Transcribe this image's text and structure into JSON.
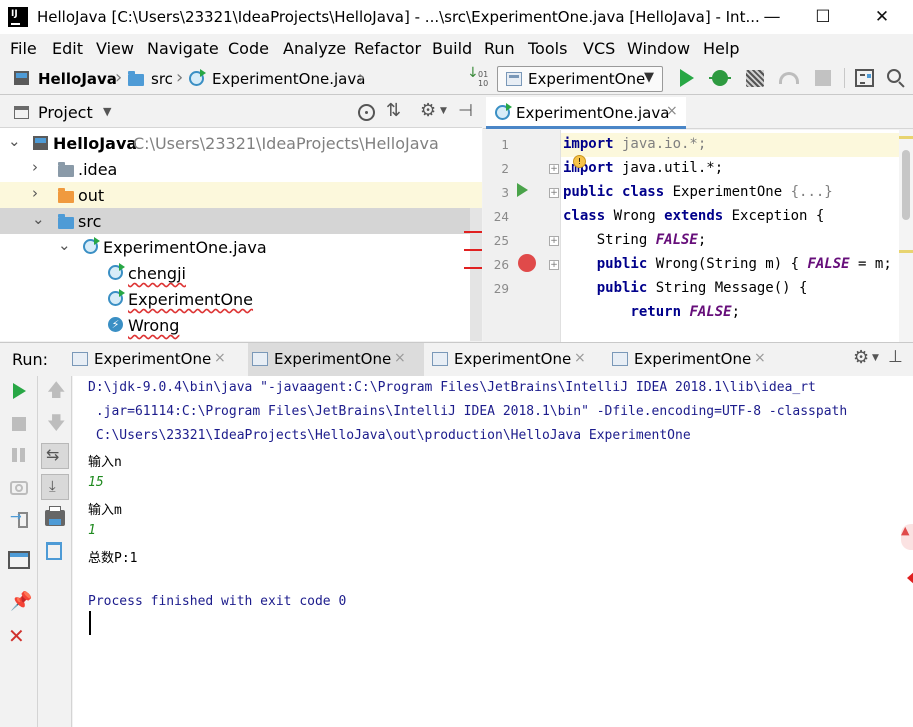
{
  "window": {
    "title": "HelloJava [C:\\Users\\23321\\IdeaProjects\\HelloJava] - ...\\src\\ExperimentOne.java [HelloJava] - Int...",
    "minimize": "—",
    "maximize": "☐",
    "close": "✕"
  },
  "menu": [
    "File",
    "Edit",
    "View",
    "Navigate",
    "Code",
    "Analyze",
    "Refactor",
    "Build",
    "Run",
    "Tools",
    "VCS",
    "Window",
    "Help"
  ],
  "breadcrumbs": {
    "project": "HelloJava",
    "folder": "src",
    "file": "ExperimentOne.java"
  },
  "run_config": "ExperimentOne",
  "project_panel": {
    "title": "Project",
    "root": "HelloJava",
    "root_path": "C:\\Users\\23321\\IdeaProjects\\HelloJava",
    "items": [
      ".idea",
      "out",
      "src",
      "ExperimentOne.java",
      "chengji",
      "ExperimentOne",
      "Wrong"
    ]
  },
  "editor": {
    "tab": "ExperimentOne.java",
    "lines": [
      {
        "num": "1",
        "parts": [
          [
            "kw",
            "import"
          ],
          [
            "cm",
            " java.io.*;"
          ]
        ]
      },
      {
        "num": "2",
        "parts": [
          [
            "kw",
            "import"
          ],
          [
            "t",
            " java.util.*;"
          ]
        ]
      },
      {
        "num": "3",
        "parts": [
          [
            "kw",
            "public class"
          ],
          [
            "t",
            " ExperimentOne "
          ],
          [
            "cm",
            "{...}"
          ]
        ]
      },
      {
        "num": "24",
        "parts": [
          [
            "kw",
            "class"
          ],
          [
            "t",
            " Wrong "
          ],
          [
            "kw",
            "extends"
          ],
          [
            "t",
            " Exception {"
          ]
        ]
      },
      {
        "num": "25",
        "parts": [
          [
            "t",
            "    String "
          ],
          [
            "const",
            "FALSE"
          ],
          [
            "t",
            ";"
          ]
        ]
      },
      {
        "num": "26",
        "parts": [
          [
            "t",
            "    "
          ],
          [
            "kw",
            "public"
          ],
          [
            "t",
            " Wrong(String m) { "
          ],
          [
            "const",
            "FALSE"
          ],
          [
            "t",
            " = m; }"
          ]
        ]
      },
      {
        "num": "29",
        "parts": [
          [
            "t",
            "    "
          ],
          [
            "kw",
            "public"
          ],
          [
            "t",
            " String Message() {"
          ]
        ]
      },
      {
        "num": "",
        "parts": [
          [
            "t",
            "        "
          ],
          [
            "kw",
            "return"
          ],
          [
            "t",
            " "
          ],
          [
            "const",
            "FALSE"
          ],
          [
            "t",
            ";"
          ]
        ]
      }
    ]
  },
  "run_panel": {
    "label": "Run:",
    "tabs": [
      "ExperimentOne",
      "ExperimentOne",
      "ExperimentOne",
      "ExperimentOne"
    ],
    "console": [
      {
        "text": "D:\\jdk-9.0.4\\bin\\java \"-javaagent:C:\\Program Files\\JetBrains\\IntelliJ IDEA 2018.1\\lib\\idea_rt",
        "kind": "sys"
      },
      {
        "text": " .jar=61114:C:\\Program Files\\JetBrains\\IntelliJ IDEA 2018.1\\bin\" -Dfile.encoding=UTF-8 -classpath",
        "kind": "sys"
      },
      {
        "text": " C:\\Users\\23321\\IdeaProjects\\HelloJava\\out\\production\\HelloJava ExperimentOne",
        "kind": "sys"
      },
      {
        "text": "输入n",
        "kind": "out"
      },
      {
        "text": "15",
        "kind": "in"
      },
      {
        "text": "输入m",
        "kind": "out"
      },
      {
        "text": "1",
        "kind": "in"
      },
      {
        "text": "总数P:1",
        "kind": "out"
      },
      {
        "text": "",
        "kind": "out"
      },
      {
        "text": "Process finished with exit code 0",
        "kind": "sys"
      }
    ]
  },
  "colors": {
    "accent": "#4a86c7",
    "run_green": "#28a745",
    "console_sys": "#1c1c8c",
    "console_input": "#1f8a1f",
    "breakpoint": "#e04a4a"
  }
}
